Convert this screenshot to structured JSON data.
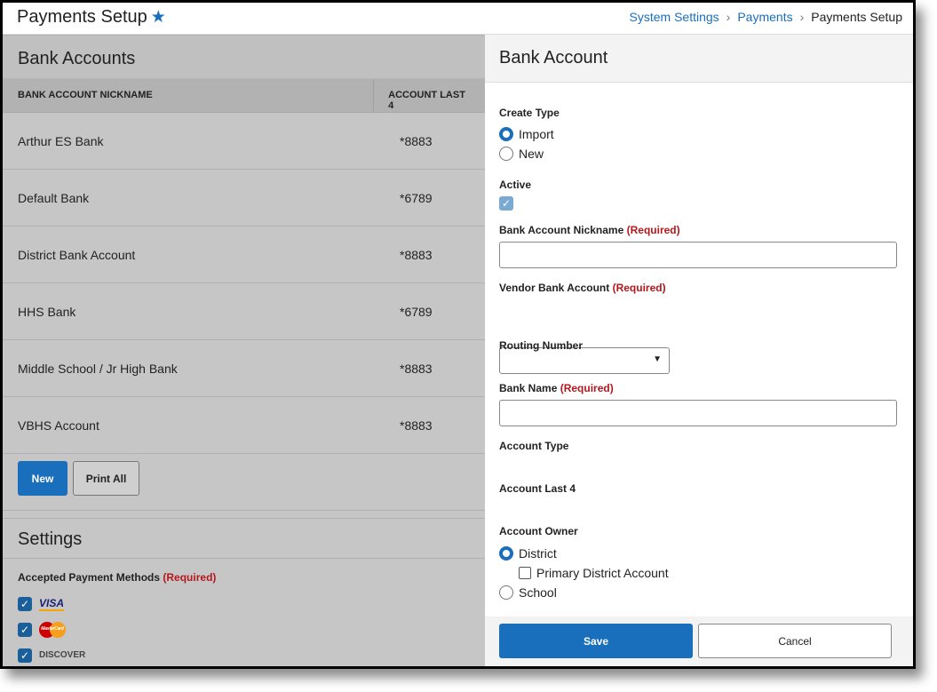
{
  "header": {
    "title": "Payments Setup",
    "breadcrumbs": [
      "System Settings",
      "Payments",
      "Payments Setup"
    ]
  },
  "bank_accounts": {
    "title": "Bank Accounts",
    "columns": [
      "BANK ACCOUNT NICKNAME",
      "ACCOUNT LAST 4"
    ],
    "rows": [
      {
        "name": "Arthur ES Bank",
        "last4": "*8883"
      },
      {
        "name": "Default Bank",
        "last4": "*6789"
      },
      {
        "name": "District Bank Account",
        "last4": "*8883"
      },
      {
        "name": "HHS Bank",
        "last4": "*6789"
      },
      {
        "name": "Middle School / Jr High Bank",
        "last4": "*8883"
      },
      {
        "name": "VBHS Account",
        "last4": "*8883"
      }
    ],
    "new_label": "New",
    "print_label": "Print All"
  },
  "settings": {
    "title": "Settings",
    "methods_label": "Accepted Payment Methods",
    "required": "(Required)",
    "methods": [
      "VISA",
      "MasterCard",
      "DISCOVER"
    ]
  },
  "detail": {
    "title": "Bank Account",
    "create_type": "Create Type",
    "import": "Import",
    "new": "New",
    "active": "Active",
    "nickname": "Bank Account Nickname",
    "vendor": "Vendor Bank Account",
    "routing": "Routing Number",
    "bank_name": "Bank Name",
    "account_type": "Account Type",
    "last4": "Account Last 4",
    "owner": "Account Owner",
    "district": "District",
    "primary": "Primary District Account",
    "school": "School",
    "required": "(Required)",
    "save": "Save",
    "cancel": "Cancel"
  }
}
